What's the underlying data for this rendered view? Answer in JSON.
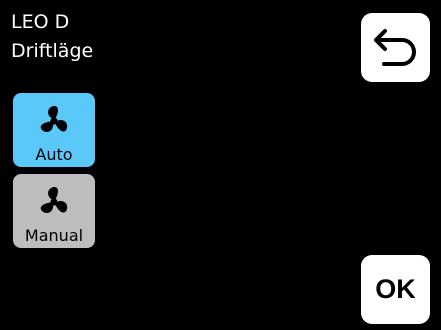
{
  "header": {
    "device_name": "LEO D",
    "screen_title": "Driftläge"
  },
  "back_button": {
    "icon": "back-arrow-icon"
  },
  "modes": [
    {
      "label": "Auto",
      "icon": "fan-icon",
      "selected": true,
      "color": "#5ac8f8"
    },
    {
      "label": "Manual",
      "icon": "fan-icon",
      "selected": false,
      "color": "#bdbdbd"
    }
  ],
  "ok_button": {
    "label": "OK"
  }
}
